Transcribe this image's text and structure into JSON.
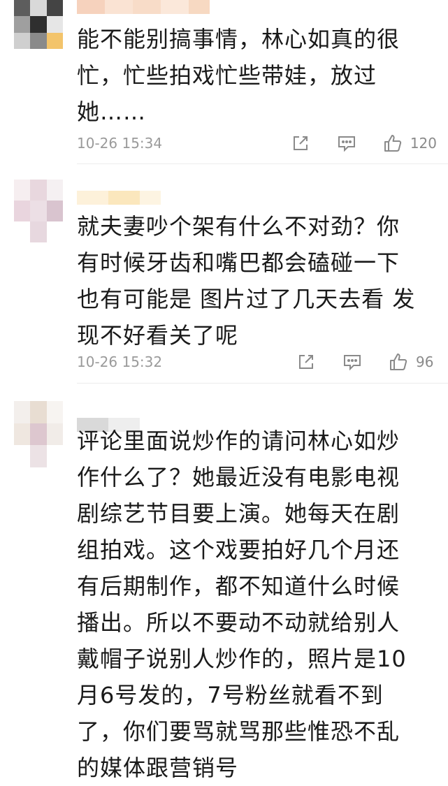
{
  "comments": [
    {
      "text": "能不能别搞事情，林心如真的很\n忙，忙些拍戏忙些带娃，放过\n她……",
      "time": "10-26 15:34",
      "likes": "120"
    },
    {
      "text": "就夫妻吵个架有什么不对劲？你\n有时候牙齿和嘴巴都会磕碰一下\n也有可能是 图片过了几天去看 发\n现不好看关了呢",
      "time": "10-26 15:32",
      "likes": "96"
    },
    {
      "text": "评论里面说炒作的请问林心如炒\n作什么了？她最近没有电影电视\n剧综艺节目要上演。她每天在剧\n组拍戏。这个戏要拍好几个月还\n有后期制作，都不知道什么时候\n播出。所以不要动不动就给别人\n戴帽子说别人炒作的，照片是10\n月6号发的，7号粉丝就看不到\n了，你们要骂就骂那些惟恐不乱\n的媒体跟营销号"
    }
  ],
  "icons": {
    "share": "share-icon",
    "comment": "comment-icon",
    "like": "thumbs-up-icon"
  },
  "colors": {
    "text": "#1a1a1a",
    "meta": "#9a9a9a",
    "icon": "#8a8a8a",
    "divider": "#ececec"
  }
}
